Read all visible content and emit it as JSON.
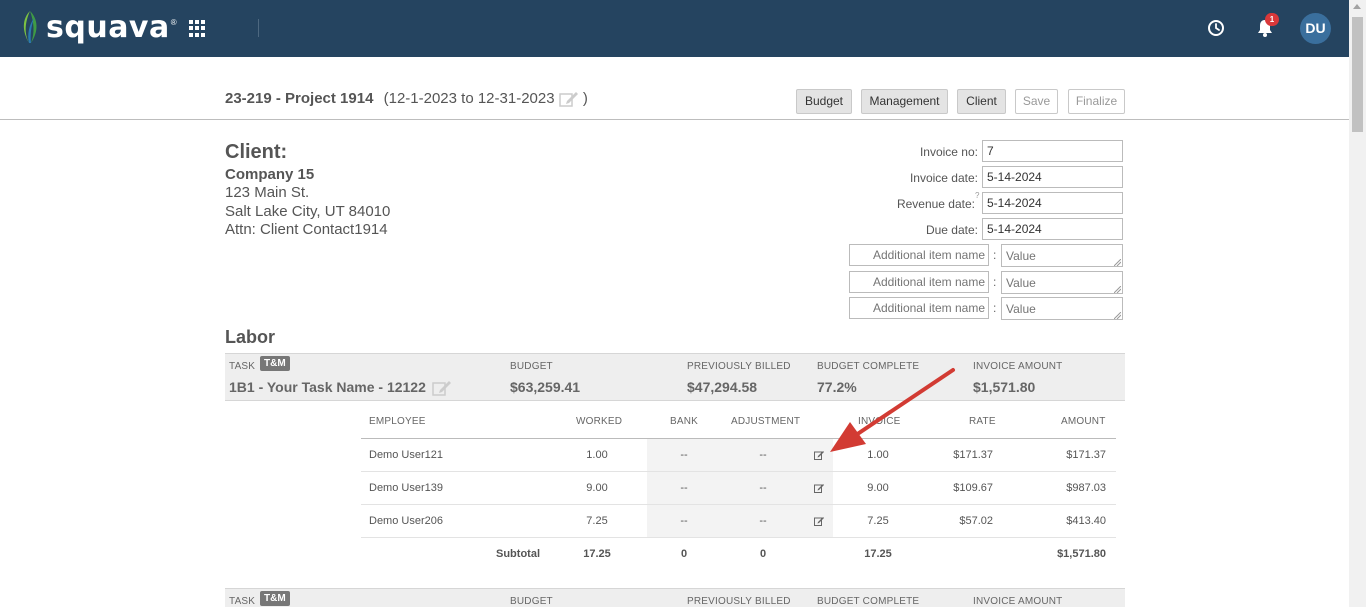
{
  "nav": {
    "logo_text": "squava",
    "logo_tm": "®",
    "notifications_count": "1",
    "avatar_initials": "DU"
  },
  "project": {
    "title": "23-219 - Project 1914",
    "dates_open": "(12-1-2023 to 12-31-2023",
    "dates_close": ")",
    "buttons": {
      "budget": "Budget",
      "management": "Management",
      "client": "Client",
      "save": "Save",
      "finalize": "Finalize"
    }
  },
  "client": {
    "heading": "Client:",
    "name": "Company 15",
    "address1": "123 Main St.",
    "address2": "Salt Lake City, UT 84010",
    "attn": "Attn: Client Contact1914"
  },
  "invoice": {
    "invoice_no_label": "Invoice no:",
    "invoice_no": "7",
    "invoice_date_label": "Invoice date:",
    "invoice_date": "5-14-2024",
    "revenue_date_label": "Revenue date:",
    "revenue_help": "?",
    "revenue_date": "5-14-2024",
    "due_date_label": "Due date:",
    "due_date": "5-14-2024",
    "additional_items": [
      {
        "name_placeholder": "Additional item name",
        "colon": ":",
        "value_placeholder": "Value"
      },
      {
        "name_placeholder": "Additional item name",
        "colon": ":",
        "value_placeholder": "Value"
      },
      {
        "name_placeholder": "Additional item name",
        "colon": ":",
        "value_placeholder": "Value"
      }
    ]
  },
  "labor": {
    "heading": "Labor",
    "task_labels": {
      "task": "TASK",
      "budget": "BUDGET",
      "previously_billed": "PREVIOUSLY BILLED",
      "budget_complete": "BUDGET COMPLETE",
      "invoice_amount": "INVOICE AMOUNT"
    },
    "tasks": [
      {
        "badge": "T&M",
        "name": "1B1 - Your Task Name - 12122",
        "budget": "$63,259.41",
        "previously_billed": "$47,294.58",
        "budget_complete": "77.2%",
        "invoice_amount": "$1,571.80"
      },
      {
        "badge": "T&M"
      }
    ],
    "columns": {
      "employee": "EMPLOYEE",
      "worked": "WORKED",
      "bank": "BANK",
      "adjustment": "ADJUSTMENT",
      "invoice": "INVOICE",
      "rate": "RATE",
      "amount": "AMOUNT"
    },
    "rows": [
      {
        "employee": "Demo User121",
        "worked": "1.00",
        "bank": "--",
        "adjustment": "--",
        "invoice": "1.00",
        "rate": "$171.37",
        "amount": "$171.37"
      },
      {
        "employee": "Demo User139",
        "worked": "9.00",
        "bank": "--",
        "adjustment": "--",
        "invoice": "9.00",
        "rate": "$109.67",
        "amount": "$987.03"
      },
      {
        "employee": "Demo User206",
        "worked": "7.25",
        "bank": "--",
        "adjustment": "--",
        "invoice": "7.25",
        "rate": "$57.02",
        "amount": "$413.40"
      }
    ],
    "subtotal": {
      "label": "Subtotal",
      "worked": "17.25",
      "bank": "0",
      "adjustment": "0",
      "invoice": "17.25",
      "amount": "$1,571.80"
    }
  },
  "colors": {
    "nav_bg": "#254460",
    "logo_green": "#5cb85c",
    "badge_red": "#d9383a",
    "annotation_arrow": "#d23b33"
  }
}
